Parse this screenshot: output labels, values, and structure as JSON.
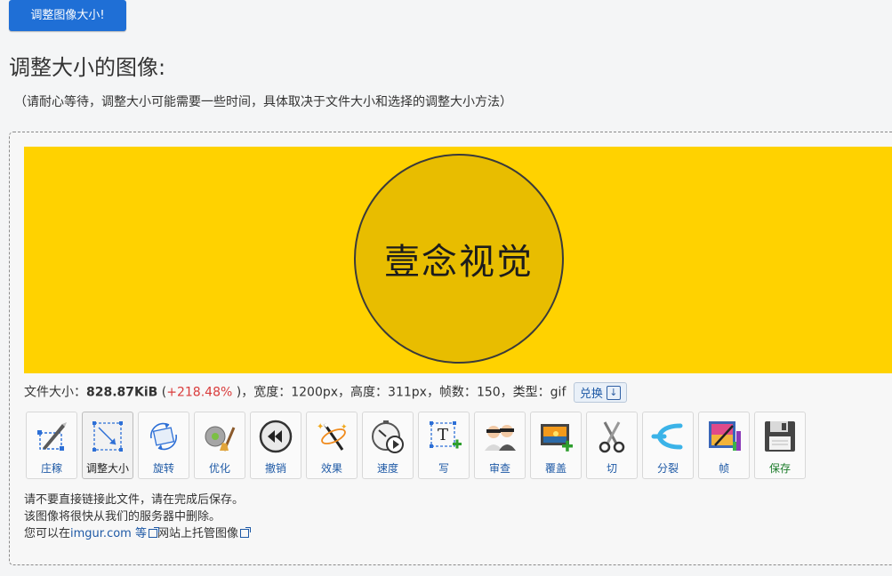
{
  "top_button": {
    "label": "调整图像大小!"
  },
  "heading": "调整大小的图像:",
  "note": "（请耐心等待，调整大小可能需要一些时间，具体取决于文件大小和选择的调整大小方法）",
  "preview": {
    "logo_text": "壹念视觉",
    "background_color": "#ffd200",
    "circle_color": "#e8bd00"
  },
  "info": {
    "file_size_label": "文件大小：",
    "file_size_value": "828.87KiB",
    "open_paren": " (",
    "change_percent": "+218.48%",
    "close_paren_sep": " )，",
    "width_label": "宽度：",
    "width_value": "1200px",
    "height_label": "，高度：",
    "height_value": "311px",
    "frames_label": "，帧数：",
    "frames_value": "150",
    "type_label": "，类型：",
    "type_value": "gif",
    "convert_label": "兑换"
  },
  "tools": [
    {
      "label": "庄稼",
      "icon": "crop-icon"
    },
    {
      "label": "调整大小",
      "icon": "resize-icon",
      "active": true
    },
    {
      "label": "旋转",
      "icon": "rotate-icon"
    },
    {
      "label": "优化",
      "icon": "optimize-icon"
    },
    {
      "label": "撤销",
      "icon": "reverse-icon"
    },
    {
      "label": "效果",
      "icon": "effects-icon"
    },
    {
      "label": "速度",
      "icon": "speed-icon"
    },
    {
      "label": "写",
      "icon": "text-icon"
    },
    {
      "label": "审查",
      "icon": "censor-icon"
    },
    {
      "label": "覆盖",
      "icon": "overlay-icon"
    },
    {
      "label": "切",
      "icon": "cut-icon"
    },
    {
      "label": "分裂",
      "icon": "split-icon"
    },
    {
      "label": "帧",
      "icon": "frames-icon"
    },
    {
      "label": "保存",
      "icon": "save-icon"
    }
  ],
  "footer": {
    "line1": "请不要直接链接此文件，请在完成后保存。",
    "line2": "该图像将很快从我们的服务器中删除。",
    "line3_prefix": "您可以在",
    "line3_link": "imgur.com 等",
    "line3_suffix": "网站上托管图像"
  }
}
